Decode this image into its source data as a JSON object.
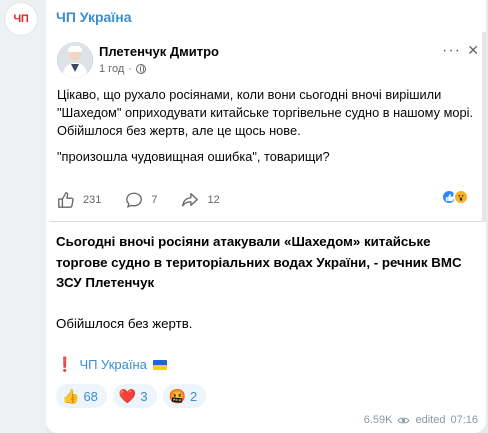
{
  "channel": {
    "avatar_text": "ЧП",
    "name": "ЧП Україна"
  },
  "embed": {
    "author": "Плетенчук Дмитро",
    "time": "1 год",
    "more_label": "···",
    "close_label": "✕",
    "paragraphs": [
      "Цікаво, що рухало росіянами, коли вони сьогодні вночі вирішили \"Шахедом\" оприходувати китайське торгівельне судно в нашому морі.",
      "Обійшлося без жертв, але це щось нове.",
      "\"произошла чудовищная ошибка\", товарищи?"
    ],
    "likes": "231",
    "comments": "7",
    "shares": "12"
  },
  "post": {
    "bold_text": "Сьогодні вночі росіяни атакували «Шахедом» китайське торгове судно в територіальних водах України, - речник ВМС ЗСУ Плетенчук",
    "plain_text": "Обійшлося без жертв.",
    "signature_mark": "❗️",
    "signature_name": "ЧП Україна"
  },
  "reactions": [
    {
      "emoji": "👍",
      "count": "68"
    },
    {
      "emoji": "❤️",
      "count": "3"
    },
    {
      "emoji": "🤬",
      "count": "2"
    }
  ],
  "footer": {
    "views": "6.59K",
    "edited": "edited",
    "time": "07:16"
  }
}
